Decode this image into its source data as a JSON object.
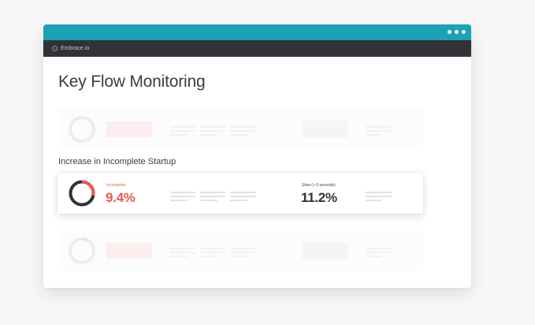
{
  "window": {
    "menu_icon": "more-dots-icon",
    "accent_color": "#1da1b3",
    "appbar_color": "#2f3338"
  },
  "app": {
    "brand": "Embrace.io",
    "logo_icon": "embrace-logo-icon"
  },
  "page": {
    "title": "Key Flow Monitoring"
  },
  "highlight": {
    "section_label": "Increase in Incomplete Startup",
    "incomplete_label": "Incomplete",
    "incomplete_value": "9.4%",
    "incomplete_color": "#e85a50",
    "incomplete_fraction": 0.094,
    "slow_label": "Slow (> 5 seconds)",
    "slow_value": "11.2%",
    "value_color": "#2f3338"
  }
}
